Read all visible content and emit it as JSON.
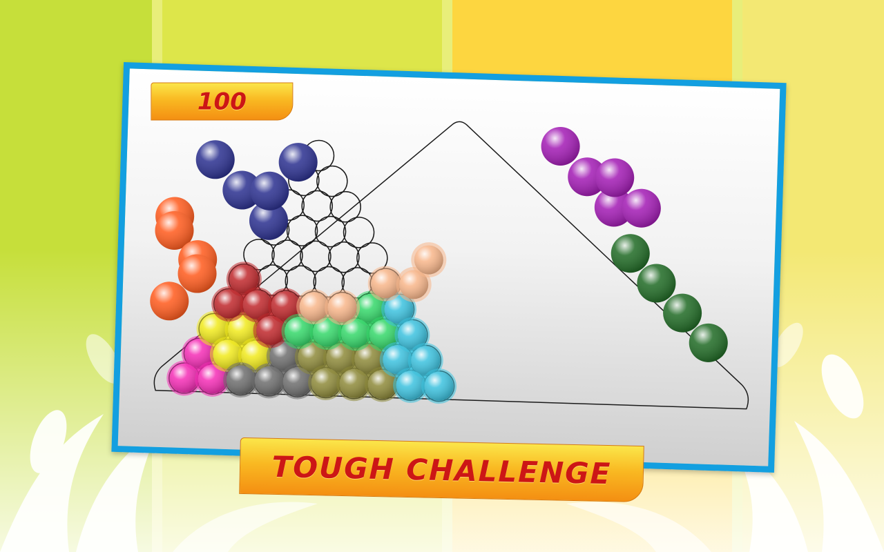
{
  "hud": {
    "score": "100"
  },
  "banner": {
    "label": "TOUGH CHALLENGE"
  },
  "colors": {
    "frame": "#139fe0",
    "board_outline": "#1a1a1a",
    "ribbon_top": "#fbe64a",
    "ribbon_bottom": "#f48f12",
    "ribbon_text": "#cc1616",
    "bg_stripes": [
      "#c6df3a",
      "#dde64a",
      "#fdd640",
      "#f3e873"
    ]
  },
  "pieces": [
    {
      "name": "blue",
      "color": "#2a2f8f",
      "cells": [
        [
          0,
          0
        ],
        [
          1,
          1
        ],
        [
          2,
          2
        ],
        [
          2,
          1
        ],
        [
          3,
          0
        ]
      ]
    },
    {
      "name": "orange",
      "color": "#ff5a1c",
      "cells": [
        [
          0,
          0
        ],
        [
          1,
          0
        ],
        [
          1,
          1
        ],
        [
          2,
          1
        ],
        [
          2,
          2
        ]
      ]
    },
    {
      "name": "purple",
      "color": "#a21ab4",
      "cells": [
        [
          0,
          0
        ],
        [
          1,
          1
        ],
        [
          2,
          2
        ],
        [
          2,
          1
        ],
        [
          3,
          2
        ]
      ]
    },
    {
      "name": "dark-green",
      "color": "#1f6a24",
      "cells": [
        [
          0,
          0
        ],
        [
          1,
          1
        ],
        [
          2,
          2
        ],
        [
          3,
          3
        ]
      ]
    }
  ],
  "board": {
    "rows": 10,
    "placed": [
      {
        "name": "pink",
        "color": "#f52db6",
        "cells": [
          [
            0,
            0
          ],
          [
            0,
            1
          ],
          [
            1,
            0
          ]
        ]
      },
      {
        "name": "yellow",
        "color": "#f1ea1c",
        "cells": [
          [
            0,
            2
          ],
          [
            1,
            1
          ],
          [
            1,
            2
          ],
          [
            2,
            1
          ]
        ]
      },
      {
        "name": "gray",
        "color": "#6e6e6e",
        "cells": [
          [
            2,
            0
          ],
          [
            3,
            0
          ],
          [
            3,
            1
          ],
          [
            4,
            0
          ]
        ]
      },
      {
        "name": "red",
        "color": "#c0282c",
        "cells": [
          [
            0,
            3
          ],
          [
            0,
            4
          ],
          [
            1,
            3
          ],
          [
            2,
            2
          ],
          [
            2,
            3
          ]
        ]
      },
      {
        "name": "olive",
        "color": "#8e8a3a",
        "cells": [
          [
            4,
            1
          ],
          [
            5,
            0
          ],
          [
            5,
            1
          ],
          [
            6,
            0
          ],
          [
            6,
            1
          ],
          [
            7,
            0
          ]
        ]
      },
      {
        "name": "green",
        "color": "#35d86a",
        "cells": [
          [
            3,
            2
          ],
          [
            4,
            2
          ],
          [
            5,
            2
          ],
          [
            5,
            3
          ],
          [
            6,
            2
          ]
        ]
      },
      {
        "name": "light-blue",
        "color": "#3cc2df",
        "cells": [
          [
            6,
            3
          ],
          [
            7,
            1
          ],
          [
            7,
            2
          ],
          [
            8,
            0
          ],
          [
            8,
            1
          ],
          [
            9,
            0
          ]
        ]
      },
      {
        "name": "peach",
        "color": "#f8b68a",
        "cells": [
          [
            3,
            3
          ],
          [
            4,
            3
          ],
          [
            5,
            4
          ],
          [
            6,
            4
          ],
          [
            6,
            5
          ]
        ]
      }
    ]
  }
}
